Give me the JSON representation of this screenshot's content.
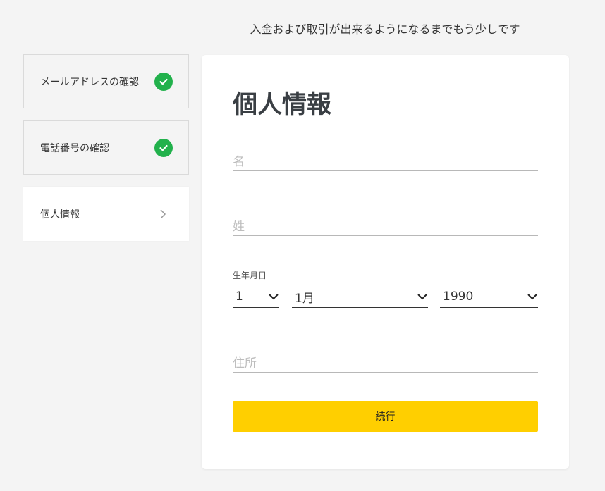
{
  "header": {
    "message": "入金および取引が出来るようになるまでもう少しです"
  },
  "steps": [
    {
      "label": "メールアドレスの確認",
      "status": "done",
      "icon": "check-icon"
    },
    {
      "label": "電話番号の確認",
      "status": "done",
      "icon": "check-icon"
    },
    {
      "label": "個人情報",
      "status": "active",
      "icon": "chevron-right-icon"
    }
  ],
  "form": {
    "title": "個人情報",
    "first_name": {
      "placeholder": "名",
      "value": ""
    },
    "last_name": {
      "placeholder": "姓",
      "value": ""
    },
    "dob": {
      "label": "生年月日",
      "day": "1",
      "month": "1月",
      "year": "1990"
    },
    "address": {
      "placeholder": "住所",
      "value": ""
    },
    "submit_label": "続行"
  },
  "colors": {
    "background": "#f4f4f4",
    "check": "#22b14c",
    "submit": "#ffcf00",
    "title": "#3a3f44"
  }
}
